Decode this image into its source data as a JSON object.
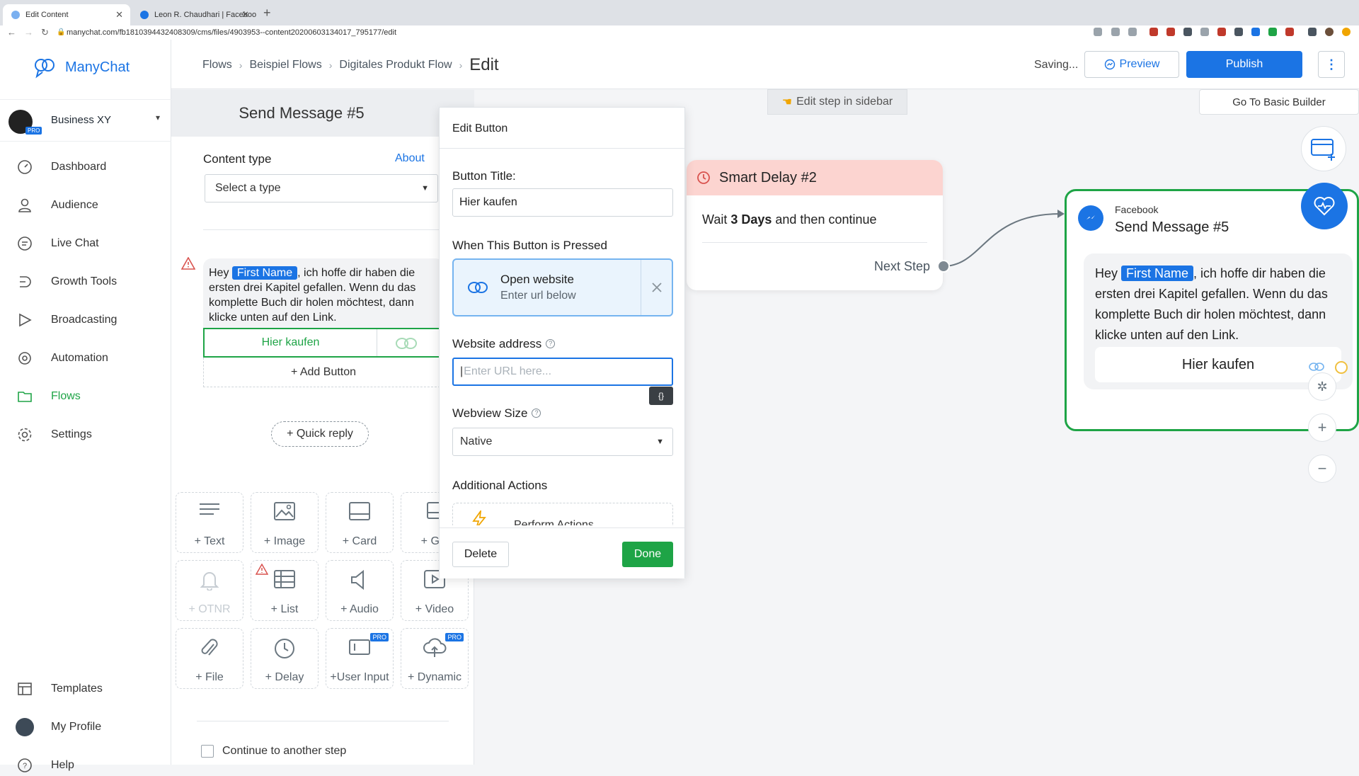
{
  "browser": {
    "tabs": [
      {
        "title": "Edit Content",
        "active": true
      },
      {
        "title": "Leon R. Chaudhari | Facebook",
        "active": false
      }
    ],
    "url": "manychat.com/fb181039443240830​9/cms/files/4903953--content20200603134017_795177/edit"
  },
  "sidebar": {
    "logo": "ManyChat",
    "account": {
      "name": "Business XY",
      "badge": "PRO"
    },
    "items": [
      {
        "label": "Dashboard",
        "icon": "dashboard-icon"
      },
      {
        "label": "Audience",
        "icon": "user-icon"
      },
      {
        "label": "Live Chat",
        "icon": "chat-icon"
      },
      {
        "label": "Growth Tools",
        "icon": "growth-icon"
      },
      {
        "label": "Broadcasting",
        "icon": "send-icon"
      },
      {
        "label": "Automation",
        "icon": "automation-icon"
      },
      {
        "label": "Flows",
        "icon": "folder-icon",
        "active": true
      },
      {
        "label": "Settings",
        "icon": "gear-icon"
      }
    ],
    "bottom": [
      {
        "label": "Templates",
        "icon": "templates-icon"
      },
      {
        "label": "My Profile",
        "icon": "avatar"
      },
      {
        "label": "Help",
        "icon": "help-icon"
      }
    ]
  },
  "topbar": {
    "breadcrumbs": [
      "Flows",
      "Beispiel Flows",
      "Digitales Produkt Flow"
    ],
    "current": "Edit",
    "status": "Saving...",
    "preview": "Preview",
    "publish": "Publish"
  },
  "canvas": {
    "edit_hint": "Edit step in sidebar",
    "basic_builder": "Go To Basic Builder"
  },
  "editor": {
    "title": "Send Message #5",
    "content_type_label": "Content type",
    "about": "About",
    "type_placeholder": "Select a type",
    "message_before": "Hey ",
    "first_name_chip": "First Name",
    "message_after": ", ich hoffe dir haben die ersten drei Kapitel gefallen. Wenn du das komplette Buch dir holen möchtest, dann klicke unten auf den Link.",
    "button_label": "Hier kaufen",
    "add_button": "+ Add Button",
    "quick_reply": "+ Quick reply",
    "tiles": [
      {
        "label": "+ Text",
        "icon": "text-icon"
      },
      {
        "label": "+ Image",
        "icon": "image-icon"
      },
      {
        "label": "+ Card",
        "icon": "card-icon"
      },
      {
        "label": "+ Gal",
        "icon": "gallery-icon"
      },
      {
        "label": "+ OTNR",
        "icon": "bell-icon",
        "dim": true
      },
      {
        "label": "+ List",
        "icon": "list-icon",
        "warn": true
      },
      {
        "label": "+ Audio",
        "icon": "audio-icon"
      },
      {
        "label": "+ Video",
        "icon": "video-icon"
      },
      {
        "label": "+ File",
        "icon": "paperclip-icon"
      },
      {
        "label": "+ Delay",
        "icon": "clock-icon"
      },
      {
        "label": "+User Input",
        "icon": "user-input-icon",
        "badge": "PRO"
      },
      {
        "label": "+ Dynamic",
        "icon": "cloud-icon",
        "badge": "PRO"
      }
    ],
    "continue_label": "Continue to another step"
  },
  "modal": {
    "title": "Edit Button",
    "button_title_label": "Button Title:",
    "button_title_value": "Hier kaufen",
    "pressed_label": "When This Button is Pressed",
    "action_title": "Open website",
    "action_sub": "Enter url below",
    "website_label": "Website address",
    "url_placeholder": "Enter URL here...",
    "variable_button": "{}",
    "webview_label": "Webview Size",
    "webview_value": "Native",
    "additional_label": "Additional Actions",
    "perform_actions": "Perform Actions",
    "delete": "Delete",
    "done": "Done"
  },
  "delay_node": {
    "title": "Smart Delay #2",
    "wait_prefix": "Wait ",
    "wait_bold": "3 Days",
    "wait_suffix": " and then continue",
    "next_step": "Next Step"
  },
  "message_node": {
    "source": "Facebook",
    "title": "Send Message #5",
    "button": "Hier kaufen"
  },
  "colors": {
    "brand_blue": "#1b74e4",
    "green": "#1ea446",
    "delay_header": "#fcd4d0"
  }
}
